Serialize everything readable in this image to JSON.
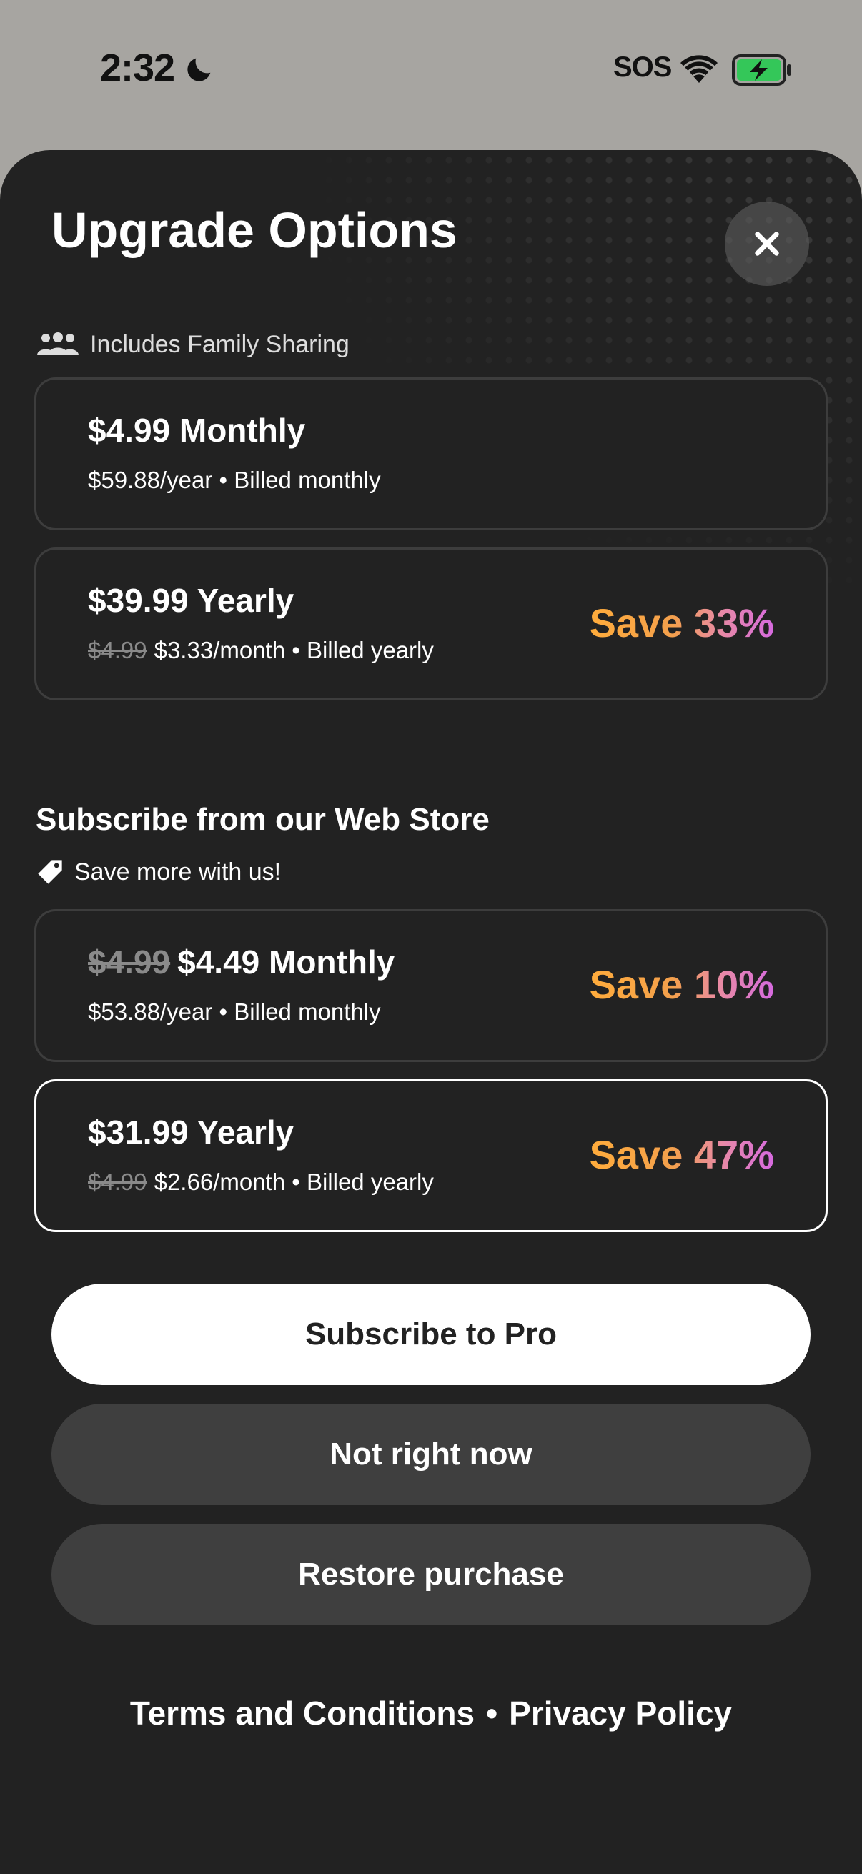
{
  "status_bar": {
    "time": "2:32",
    "carrier_text": "SOS",
    "icons": [
      "moon-icon",
      "wifi-icon",
      "battery-charging-icon"
    ],
    "battery_color": "#34c759"
  },
  "sheet": {
    "title": "Upgrade Options",
    "close_icon": "close-icon"
  },
  "app_store": {
    "family_sharing_label": "Includes Family Sharing",
    "plans": [
      {
        "title": "$4.99 Monthly",
        "subtitle": "$59.88/year • Billed monthly",
        "save": ""
      },
      {
        "title": "$39.99 Yearly",
        "strike": "$4.99",
        "subtitle": "$3.33/month • Billed yearly",
        "save": "Save 33%"
      }
    ]
  },
  "web_store": {
    "title": "Subscribe from our Web Store",
    "note": "Save more with us!",
    "plans": [
      {
        "title_strike": "$4.99",
        "title": "$4.49 Monthly",
        "subtitle": "$53.88/year • Billed monthly",
        "save": "Save 10%"
      },
      {
        "title": "$31.99 Yearly",
        "strike": "$4.99",
        "subtitle": "$2.66/month • Billed yearly",
        "save": "Save 47%",
        "selected": true
      }
    ]
  },
  "buttons": {
    "subscribe": "Subscribe to Pro",
    "not_now": "Not right now",
    "restore": "Restore purchase"
  },
  "footer": {
    "terms": "Terms and Conditions",
    "separator": "•",
    "privacy": "Privacy Policy"
  },
  "colors": {
    "sheet_background": "#222222",
    "save_gradient_start": "#ffac3c",
    "save_gradient_end": "#d66ae0"
  }
}
